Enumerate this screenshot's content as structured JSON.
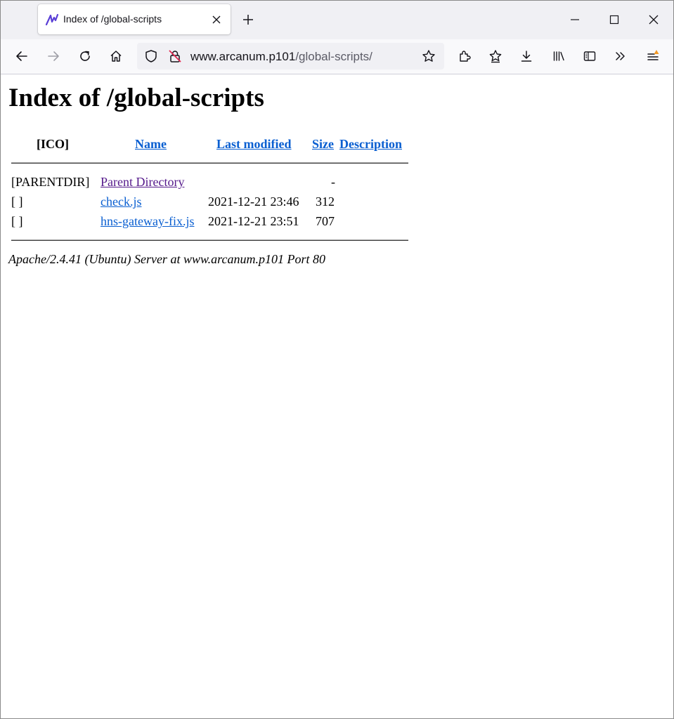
{
  "browser": {
    "tab_title": "Index of /global-scripts",
    "url_host": "www.arcanum.p101",
    "url_path": "/global-scripts/"
  },
  "page": {
    "heading": "Index of /global-scripts",
    "columns": {
      "icon": "[ICO]",
      "name": "Name",
      "last_modified": "Last modified",
      "size": "Size",
      "description": "Description"
    },
    "rows": [
      {
        "icon": "[PARENTDIR]",
        "name": "Parent Directory",
        "last_modified": "",
        "size": "-"
      },
      {
        "icon": "[ ]",
        "name": "check.js",
        "last_modified": "2021-12-21 23:46",
        "size": "312"
      },
      {
        "icon": "[ ]",
        "name": "hns-gateway-fix.js",
        "last_modified": "2021-12-21 23:51",
        "size": "707"
      }
    ],
    "address": "Apache/2.4.41 (Ubuntu) Server at www.arcanum.p101 Port 80"
  },
  "colors": {
    "link": "#0a5fd1",
    "visited_link": "#551a8b",
    "favicon": "#5a3fd6",
    "notification_dot": "#f39a27"
  },
  "icons": {
    "tab_favicon": "arcanum-logo-icon",
    "back": "arrow-left-icon",
    "forward": "arrow-right-icon",
    "reload": "reload-icon",
    "home": "home-icon",
    "tracking_protection": "shield-icon",
    "insecure": "lock-strikethrough-icon",
    "bookmark": "star-icon",
    "extensions": "puzzle-icon",
    "pocket": "star-outline-icon",
    "downloads": "download-icon",
    "library": "library-icon",
    "sidebar": "sidebar-icon",
    "overflow": "chevron-double-right-icon",
    "menu": "hamburger-menu-icon"
  }
}
